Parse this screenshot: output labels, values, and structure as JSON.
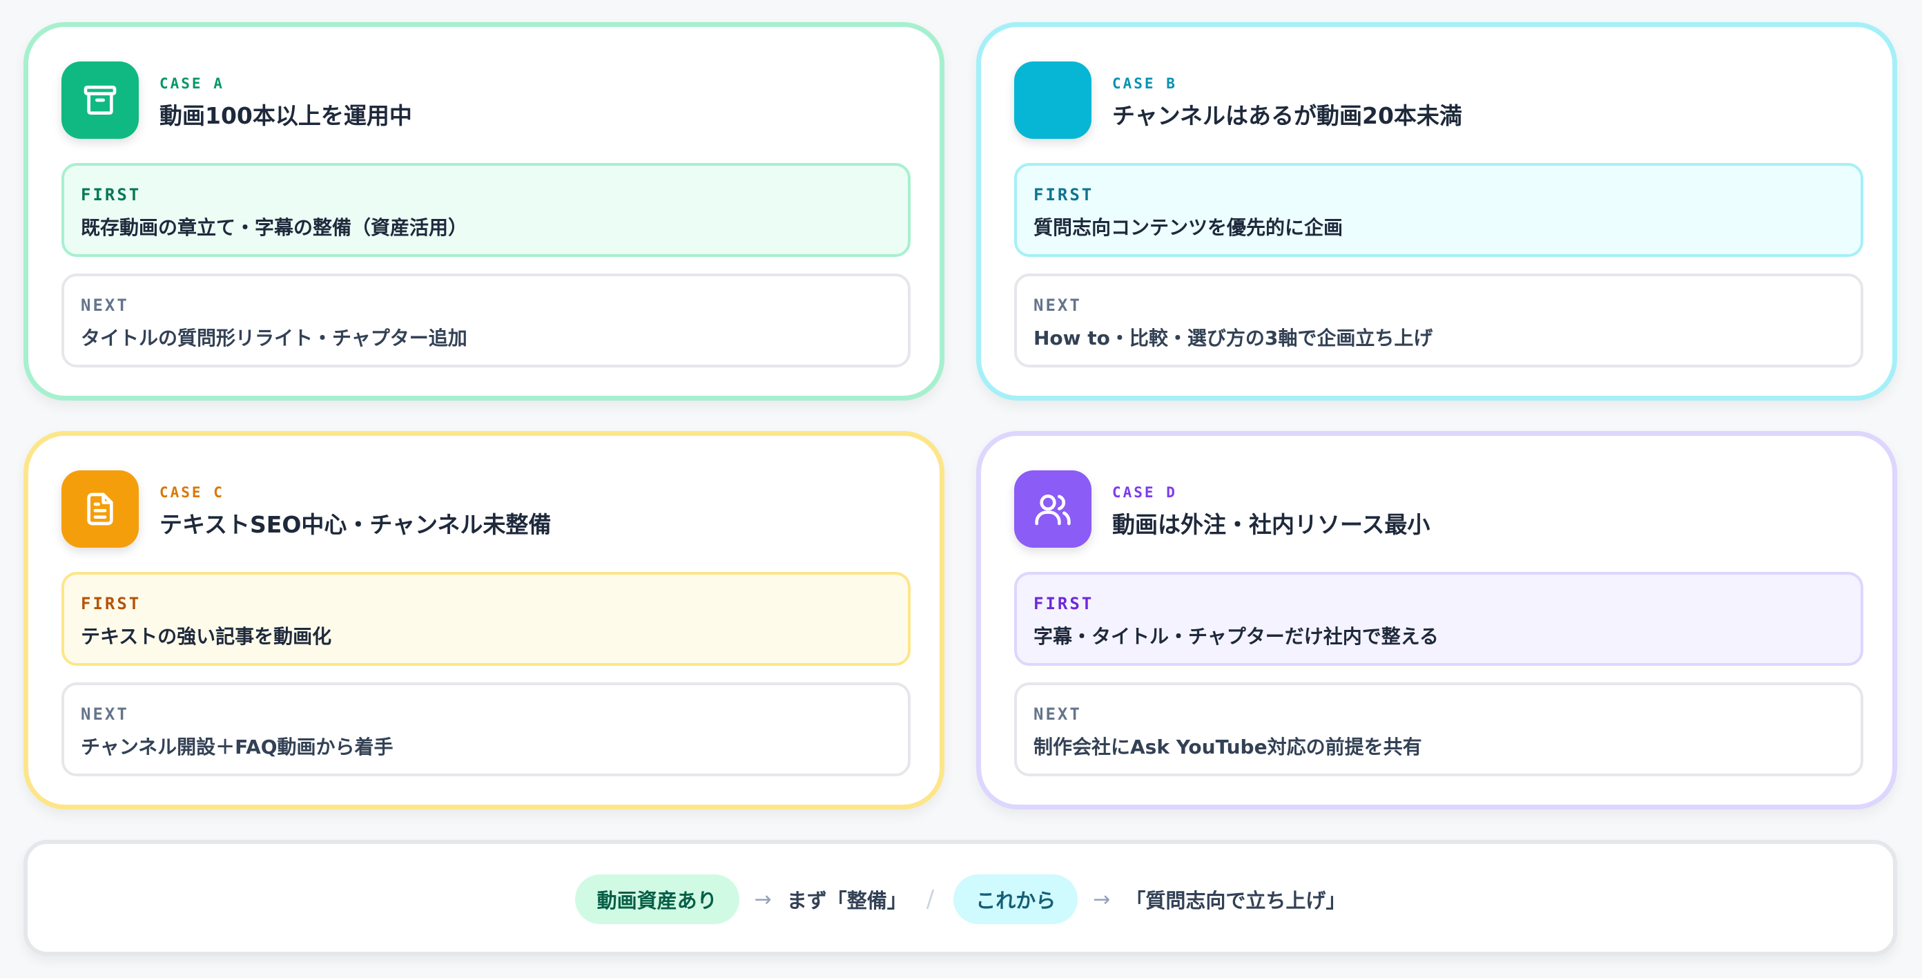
{
  "cases": {
    "a": {
      "case_label": "CASE A",
      "title": "動画100本以上を運用中",
      "icon": "archive-icon",
      "accent": "#10b981",
      "first_label": "FIRST",
      "first_text": "既存動画の章立て・字幕の整備（資産活用）",
      "next_label": "NEXT",
      "next_text": "タイトルの質問形リライト・チャプター追加"
    },
    "b": {
      "case_label": "CASE B",
      "title": "チャンネルはあるが動画20本未満",
      "icon": "",
      "accent": "#06b6d4",
      "first_label": "FIRST",
      "first_text": "質問志向コンテンツを優先的に企画",
      "next_label": "NEXT",
      "next_text": "How to・比較・選び方の3軸で企画立ち上げ"
    },
    "c": {
      "case_label": "CASE C",
      "title": "テキストSEO中心・チャンネル未整備",
      "icon": "document-icon",
      "accent": "#f59e0b",
      "first_label": "FIRST",
      "first_text": "テキストの強い記事を動画化",
      "next_label": "NEXT",
      "next_text": "チャンネル開設＋FAQ動画から着手"
    },
    "d": {
      "case_label": "CASE D",
      "title": "動画は外注・社内リソース最小",
      "icon": "users-icon",
      "accent": "#8b5cf6",
      "first_label": "FIRST",
      "first_text": "字幕・タイトル・チャプターだけ社内で整える",
      "next_label": "NEXT",
      "next_text": "制作会社にAsk YouTube対応の前提を共有"
    }
  },
  "summary": {
    "pill_1": "動画資産あり",
    "arrow_1": "→",
    "phrase_1": "まず「整備」",
    "separator": "/",
    "pill_2": "これから",
    "arrow_2": "→",
    "phrase_2": "「質問志向で立ち上げ」"
  }
}
